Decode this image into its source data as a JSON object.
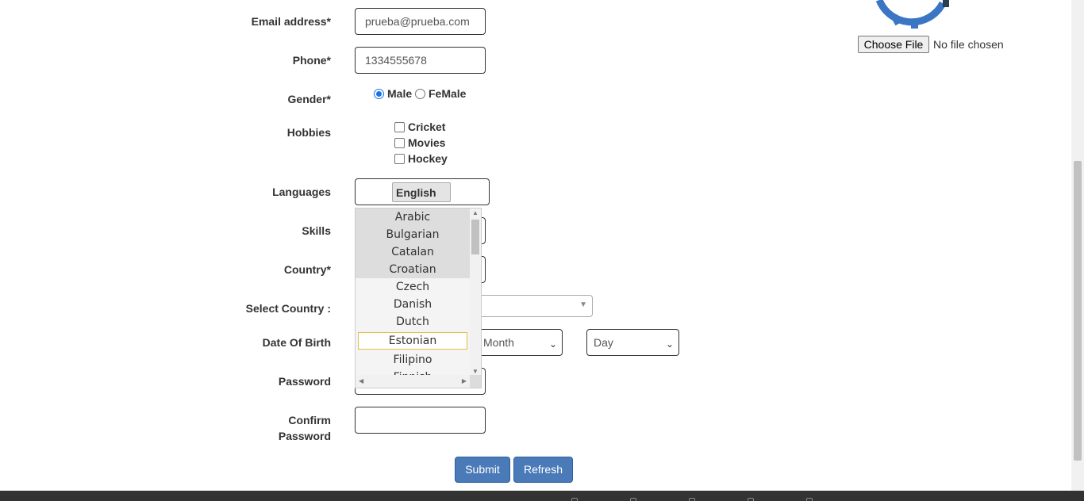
{
  "form": {
    "email": {
      "label": "Email address*",
      "value": "prueba@prueba.com"
    },
    "phone": {
      "label": "Phone*",
      "value": "1334555678"
    },
    "gender": {
      "label": "Gender*",
      "options": [
        "Male",
        "FeMale"
      ],
      "selected": "Male"
    },
    "hobbies": {
      "label": "Hobbies",
      "options": [
        "Cricket",
        "Movies",
        "Hockey"
      ]
    },
    "languages": {
      "label": "Languages",
      "selected_chip": "English",
      "dropdown_items": [
        "Arabic",
        "Bulgarian",
        "Catalan",
        "Croatian",
        "Czech",
        "Danish",
        "Dutch",
        "Estonian",
        "Filipino",
        "Finnish"
      ]
    },
    "skills": {
      "label": "Skills"
    },
    "country": {
      "label": "Country*"
    },
    "select_country": {
      "label": "Select Country :"
    },
    "dob": {
      "label": "Date Of Birth",
      "month": "Month",
      "day": "Day"
    },
    "password": {
      "label": "Password"
    },
    "confirm_password": {
      "label_line1": "Confirm",
      "label_line2": "Password"
    },
    "submit_label": "Submit",
    "refresh_label": "Refresh"
  },
  "file_upload": {
    "button": "Choose File",
    "status": "No file chosen"
  },
  "colors": {
    "button": "#4a7ab8",
    "logo": "#3b76c4"
  }
}
